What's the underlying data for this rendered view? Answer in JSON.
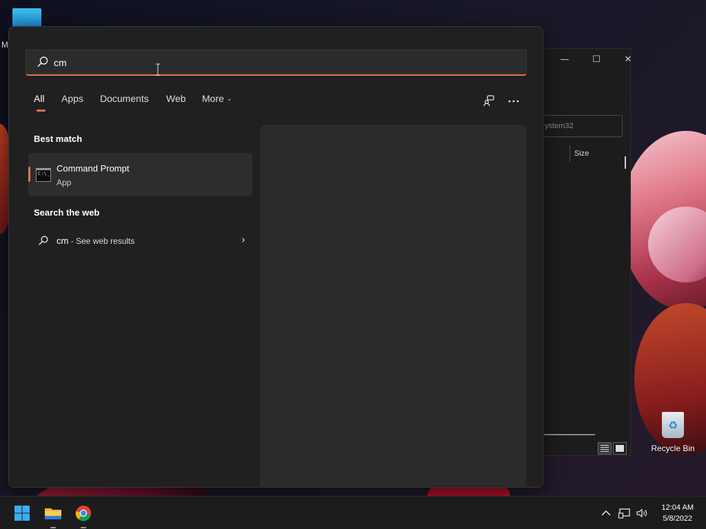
{
  "desktop": {
    "edge_letter": "M",
    "recycle_bin_label": "Recycle Bin"
  },
  "explorer": {
    "path_text": "ystem32",
    "column_size": "Size",
    "controls": {
      "minimize": "—",
      "maximize": "☐",
      "close": "✕"
    }
  },
  "search": {
    "query": "cm",
    "tabs": [
      {
        "label": "All",
        "active": true
      },
      {
        "label": "Apps"
      },
      {
        "label": "Documents"
      },
      {
        "label": "Web"
      },
      {
        "label": "More"
      }
    ],
    "best_match": {
      "section_title": "Best match",
      "title": "Command Prompt",
      "subtitle": "App",
      "icon": "command-prompt-icon"
    },
    "web": {
      "section_title": "Search the web",
      "query": "cm",
      "suffix": " - See web results"
    },
    "accent_color": "#e8734f"
  },
  "taskbar": {
    "apps": [
      {
        "name": "start",
        "icon": "windows-logo-icon"
      },
      {
        "name": "file-explorer",
        "icon": "folder-icon"
      },
      {
        "name": "chrome",
        "icon": "chrome-icon"
      }
    ],
    "clock": {
      "time": "12:04 AM",
      "date": "5/8/2022"
    }
  }
}
